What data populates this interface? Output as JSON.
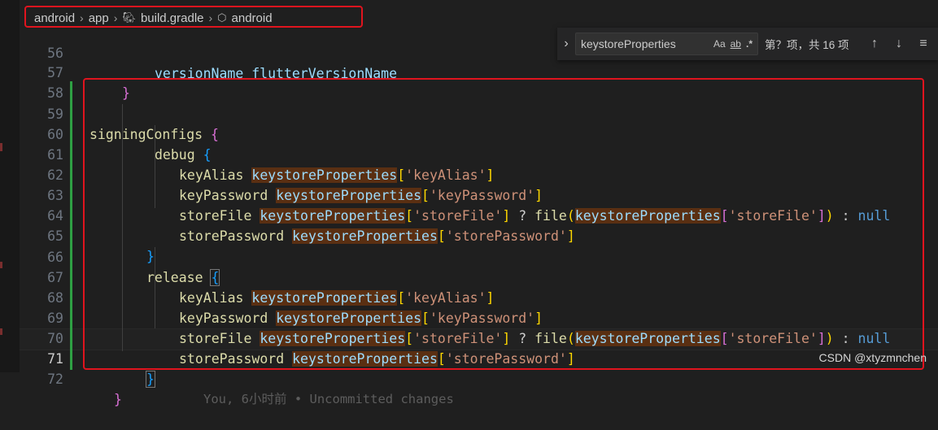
{
  "breadcrumb": [
    "android",
    "app",
    "build.gradle",
    "android"
  ],
  "find": {
    "query": "keystoreProperties",
    "opt_case": "Aa",
    "opt_word": "ab",
    "opt_regex": ".*",
    "result": "第？项，共 16 项"
  },
  "code": {
    "l56": {
      "num": "56",
      "text": "versionName flutterVersionName"
    },
    "l57": {
      "num": "57",
      "brace": "}"
    },
    "l58": {
      "num": "58"
    },
    "l59": {
      "num": "59",
      "name": "signingConfigs",
      "brace": "{"
    },
    "l60": {
      "num": "60",
      "name": "debug",
      "brace": "{"
    },
    "l61": {
      "num": "61",
      "prop": "keyAlias",
      "ref": "keystoreProperties",
      "open": "[",
      "key": "'keyAlias'",
      "close": "]"
    },
    "l62": {
      "num": "62",
      "prop": "keyPassword",
      "ref": "keystoreProperties",
      "open": "[",
      "key": "'keyPassword'",
      "close": "]"
    },
    "l63": {
      "num": "63",
      "prop": "storeFile",
      "ref": "keystoreProperties",
      "open": "[",
      "key": "'storeFile'",
      "close": "]",
      "op": " ? ",
      "fn": "file",
      "paren_open": "(",
      "ref2": "keystoreProperties",
      "open2": "[",
      "key2": "'storeFile'",
      "close2": "]",
      "paren_close": ")",
      "colon": " : ",
      "null": "null"
    },
    "l64": {
      "num": "64",
      "prop": "storePassword",
      "ref": "keystoreProperties",
      "open": "[",
      "key": "'storePassword'",
      "close": "]"
    },
    "l65": {
      "num": "65",
      "brace": "}"
    },
    "l66": {
      "num": "66",
      "name": "release",
      "brace": "{"
    },
    "l67": {
      "num": "67",
      "prop": "keyAlias",
      "ref": "keystoreProperties",
      "open": "[",
      "key": "'keyAlias'",
      "close": "]"
    },
    "l68": {
      "num": "68",
      "prop": "keyPassword",
      "ref": "keystoreProperties",
      "open": "[",
      "key": "'keyPassword'",
      "close": "]"
    },
    "l69": {
      "num": "69",
      "prop": "storeFile",
      "ref": "keystoreProperties",
      "open": "[",
      "key": "'storeFile'",
      "close": "]",
      "op": " ? ",
      "fn": "file",
      "paren_open": "(",
      "ref2": "keystoreProperties",
      "open2": "[",
      "key2": "'storeFile'",
      "close2": "]",
      "paren_close": ")",
      "colon": " : ",
      "null": "null"
    },
    "l70": {
      "num": "70",
      "prop": "storePassword",
      "ref": "keystoreProperties",
      "open": "[",
      "key": "'storePassword'",
      "close": "]"
    },
    "l71": {
      "num": "71",
      "brace": "}",
      "blame": "You, 6小时前 • Uncommitted changes"
    },
    "l72": {
      "num": "72",
      "brace": "}"
    }
  },
  "watermark": "CSDN @xtyzmnchen"
}
